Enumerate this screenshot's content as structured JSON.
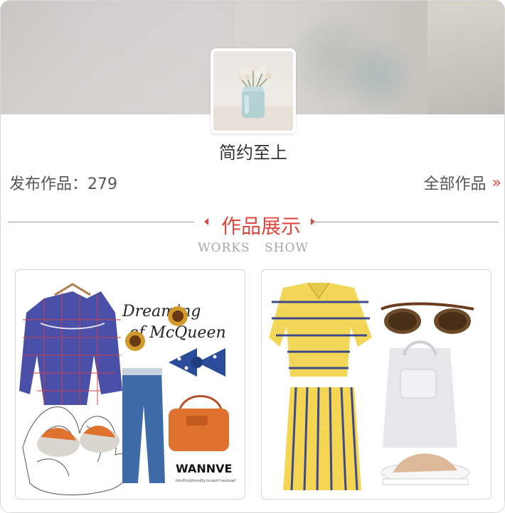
{
  "profile": {
    "name": "简约至上"
  },
  "stats": {
    "published_label": "发布作品：279",
    "all_works_label": "全部作品",
    "all_works_arrow": "»"
  },
  "section": {
    "title": "作品展示",
    "subtitle": "WORKS  SHOW"
  },
  "works": [
    {
      "brand_logo": "WANNVE",
      "script_text": "Dreaming of McQueen"
    },
    {}
  ],
  "colors": {
    "accent": "#e0483e",
    "text": "#333333",
    "muted": "#a6a6a6"
  }
}
